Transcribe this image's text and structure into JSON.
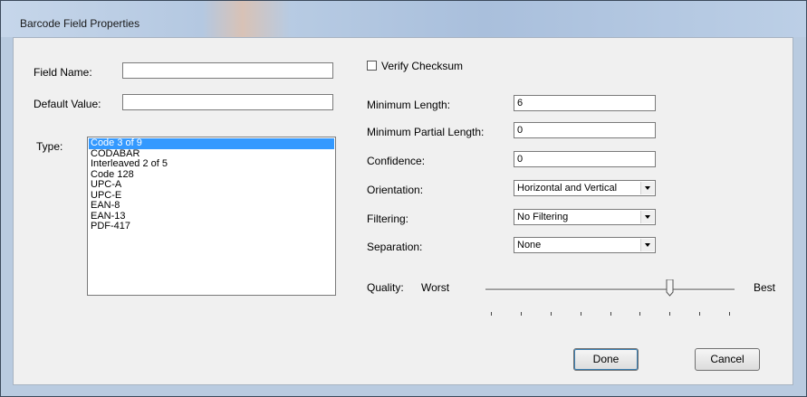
{
  "window": {
    "title": "Barcode Field Properties"
  },
  "left": {
    "field_name_label": "Field Name:",
    "field_name_value": "",
    "default_value_label": "Default Value:",
    "default_value_value": "",
    "type_label": "Type:",
    "type_options": [
      "Code 3 of 9",
      "CODABAR",
      "Interleaved 2 of 5",
      "Code 128",
      "UPC-A",
      "UPC-E",
      "EAN-8",
      "EAN-13",
      "PDF-417"
    ],
    "type_selected": "Code 3 of 9"
  },
  "right": {
    "verify_checksum_label": "Verify Checksum",
    "verify_checksum_checked": false,
    "min_length_label": "Minimum Length:",
    "min_length_value": "6",
    "min_partial_length_label": "Minimum Partial Length:",
    "min_partial_length_value": "0",
    "confidence_label": "Confidence:",
    "confidence_value": "0",
    "orientation_label": "Orientation:",
    "orientation_value": "Horizontal and Vertical",
    "filtering_label": "Filtering:",
    "filtering_value": "No Filtering",
    "separation_label": "Separation:",
    "separation_value": "None",
    "quality_label": "Quality:",
    "quality_min_label": "Worst",
    "quality_max_label": "Best",
    "quality_tick_count": 9,
    "quality_value_fraction": 0.75
  },
  "buttons": {
    "done": "Done",
    "cancel": "Cancel"
  }
}
